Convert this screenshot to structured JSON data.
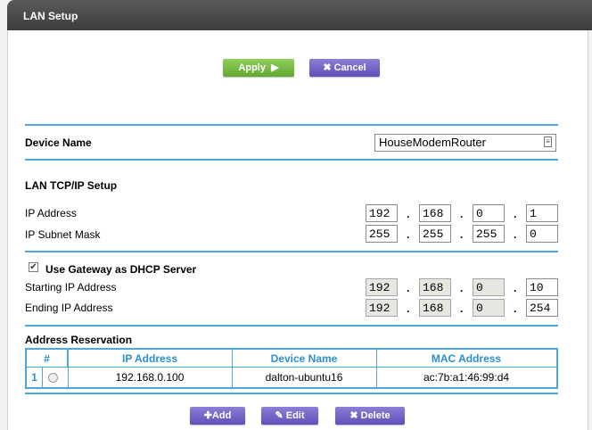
{
  "header": {
    "title": "LAN Setup"
  },
  "actions": {
    "apply_label": "Apply",
    "apply_icon": "play-right-icon",
    "cancel_label": "Cancel",
    "cancel_icon": "close-icon"
  },
  "device": {
    "label": "Device Name",
    "value": "HouseModemRouter",
    "field_icon": "contact-card-icon"
  },
  "lan_tcpip": {
    "section_title": "LAN TCP/IP Setup",
    "ip_address": {
      "label": "IP Address",
      "octets": [
        "192",
        "168",
        "0",
        "1"
      ]
    },
    "subnet_mask": {
      "label": "IP Subnet Mask",
      "octets": [
        "255",
        "255",
        "255",
        "0"
      ]
    }
  },
  "dhcp": {
    "checkbox_label": "Use Gateway as DHCP Server",
    "checked": true,
    "starting": {
      "label": "Starting IP Address",
      "octets": [
        "192",
        "168",
        "0",
        "10"
      ]
    },
    "ending": {
      "label": "Ending IP Address",
      "octets": [
        "192",
        "168",
        "0",
        "254"
      ]
    }
  },
  "reservation": {
    "title": "Address Reservation",
    "columns": [
      "#",
      "IP Address",
      "Device Name",
      "MAC Address"
    ],
    "rows": [
      {
        "index": "1",
        "ip": "192.168.0.100",
        "device": "dalton-ubuntu16",
        "mac": "ac:7b:a1:46:99:d4"
      }
    ]
  },
  "table_actions": {
    "add_label": "Add",
    "add_icon": "plus-icon",
    "edit_label": "Edit",
    "edit_icon": "pencil-icon",
    "delete_label": "Delete",
    "delete_icon": "close-icon"
  },
  "colors": {
    "accent_blue": "#4fa7d6",
    "header_text_blue": "#2a8fd0",
    "apply_green": "#62a832",
    "button_purple": "#5f4fb8",
    "titlebar": "#3d3d3d"
  }
}
